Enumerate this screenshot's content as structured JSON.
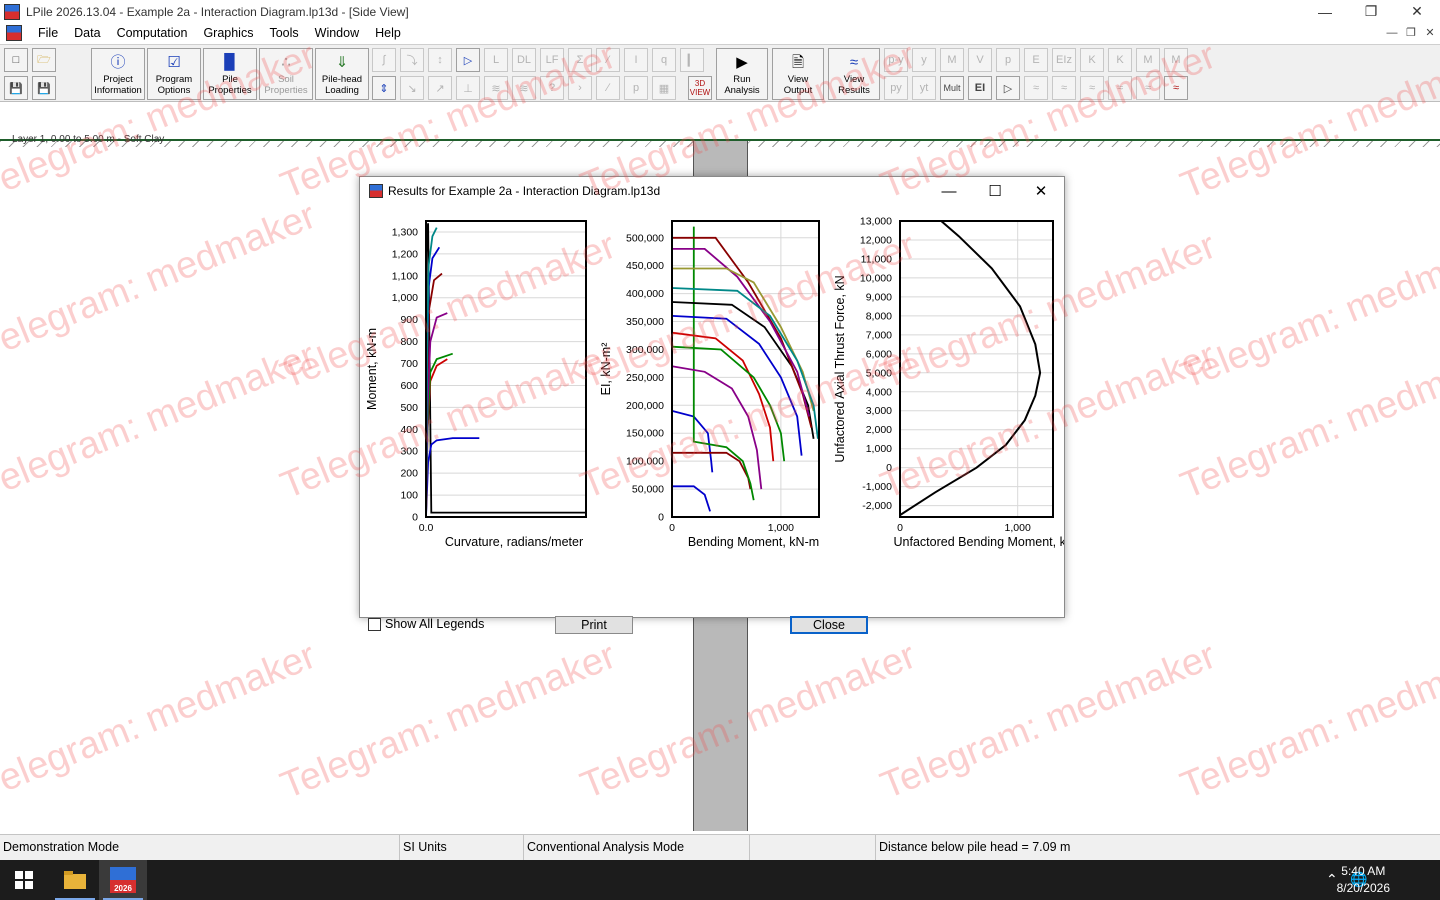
{
  "window": {
    "title": "LPile 2026.13.04 - Example 2a - Interaction Diagram.lp13d - [Side View]"
  },
  "menu": [
    "File",
    "Data",
    "Computation",
    "Graphics",
    "Tools",
    "Window",
    "Help"
  ],
  "toolbar": {
    "project_info": "Project Information",
    "program_options": "Program Options",
    "pile_properties": "Pile Properties",
    "soil_properties": "Soil Properties",
    "pilehead_loading": "Pile-head Loading",
    "view_3d": "3D VIEW",
    "run_analysis": "Run Analysis",
    "view_output": "View Output",
    "view_results": "View Results",
    "mult_label": "Mult",
    "ei_label": "EI"
  },
  "workspace": {
    "layer_label": "Layer 1, 0.00 to 5.00 m - Soft Clay"
  },
  "dialog": {
    "title": "Results for Example 2a - Interaction Diagram.lp13d",
    "show_all_legends": "Show All Legends",
    "print": "Print",
    "close": "Close"
  },
  "chart_data": [
    {
      "type": "line",
      "xlabel": "Curvature, radians/meter",
      "ylabel": "Moment, kN-m",
      "xticks": [
        "0.0"
      ],
      "yticks": [
        0,
        100,
        200,
        300,
        400,
        500,
        600,
        700,
        800,
        900,
        1000,
        1100,
        1200,
        1300
      ],
      "ytick_labels": [
        "0",
        "100",
        "200",
        "300",
        "400",
        "500",
        "600",
        "700",
        "800",
        "900",
        "1,000",
        "1,100",
        "1,200",
        "1,300"
      ],
      "ylim": [
        0,
        1350
      ],
      "xlim": [
        0,
        0.3
      ],
      "series": [
        {
          "color": "#000000",
          "x": [
            0,
            0.001,
            0.002,
            0.004,
            0.01,
            0.3
          ],
          "y": [
            0,
            1200,
            1300,
            1340,
            20,
            20
          ]
        },
        {
          "color": "#0000cc",
          "x": [
            0,
            0.004,
            0.01,
            0.02,
            0.05,
            0.1
          ],
          "y": [
            0,
            250,
            330,
            350,
            360,
            360
          ]
        },
        {
          "color": "#cc0000",
          "x": [
            0,
            0.003,
            0.008,
            0.02,
            0.04
          ],
          "y": [
            0,
            400,
            620,
            690,
            720
          ]
        },
        {
          "color": "#008800",
          "x": [
            0,
            0.003,
            0.008,
            0.02,
            0.05
          ],
          "y": [
            0,
            420,
            660,
            720,
            745
          ]
        },
        {
          "color": "#880088",
          "x": [
            0,
            0.003,
            0.008,
            0.02,
            0.04
          ],
          "y": [
            0,
            500,
            800,
            910,
            930
          ]
        },
        {
          "color": "#880000",
          "x": [
            0,
            0.002,
            0.006,
            0.015,
            0.03
          ],
          "y": [
            0,
            600,
            950,
            1080,
            1110
          ]
        },
        {
          "color": "#0000cc",
          "x": [
            0,
            0.002,
            0.005,
            0.012,
            0.025
          ],
          "y": [
            0,
            700,
            1050,
            1180,
            1230
          ]
        },
        {
          "color": "#008888",
          "x": [
            0,
            0.002,
            0.005,
            0.012,
            0.02
          ],
          "y": [
            0,
            750,
            1150,
            1280,
            1320
          ]
        }
      ]
    },
    {
      "type": "line",
      "xlabel": "Bending Moment, kN-m",
      "ylabel": "EI, kN-m²",
      "xticks": [
        0,
        1000
      ],
      "xtick_labels": [
        "0",
        "1,000"
      ],
      "yticks": [
        0,
        50000,
        100000,
        150000,
        200000,
        250000,
        300000,
        350000,
        400000,
        450000,
        500000
      ],
      "ytick_labels": [
        "0",
        "50,000",
        "100,000",
        "150,000",
        "200,000",
        "250,000",
        "300,000",
        "350,000",
        "400,000",
        "450,000",
        "500,000"
      ],
      "xlim": [
        0,
        1350
      ],
      "ylim": [
        0,
        530000
      ],
      "series": [
        {
          "color": "#0000cc",
          "x": [
            0,
            200,
            300,
            350
          ],
          "y": [
            55000,
            55000,
            40000,
            10000
          ]
        },
        {
          "color": "#0000cc",
          "x": [
            0,
            200,
            330,
            360,
            370
          ],
          "y": [
            190000,
            180000,
            150000,
            100000,
            80000
          ]
        },
        {
          "color": "#880000",
          "x": [
            0,
            300,
            500,
            620,
            700,
            720
          ],
          "y": [
            115000,
            115000,
            115000,
            100000,
            70000,
            50000
          ]
        },
        {
          "color": "#008800",
          "x": [
            200,
            200,
            500,
            650,
            720,
            750
          ],
          "y": [
            520000,
            135000,
            125000,
            100000,
            60000,
            30000
          ]
        },
        {
          "color": "#880088",
          "x": [
            0,
            300,
            550,
            700,
            780,
            820
          ],
          "y": [
            270000,
            260000,
            230000,
            180000,
            120000,
            50000
          ]
        },
        {
          "color": "#cc0000",
          "x": [
            0,
            400,
            650,
            800,
            900,
            930
          ],
          "y": [
            330000,
            320000,
            280000,
            220000,
            160000,
            100000
          ]
        },
        {
          "color": "#008800",
          "x": [
            0,
            450,
            750,
            900,
            1000,
            1030
          ],
          "y": [
            305000,
            300000,
            250000,
            200000,
            150000,
            100000
          ]
        },
        {
          "color": "#0000cc",
          "x": [
            0,
            500,
            800,
            1000,
            1150,
            1190
          ],
          "y": [
            360000,
            355000,
            310000,
            250000,
            180000,
            110000
          ]
        },
        {
          "color": "#000000",
          "x": [
            0,
            550,
            850,
            1100,
            1250,
            1300
          ],
          "y": [
            385000,
            380000,
            340000,
            270000,
            200000,
            140000
          ]
        },
        {
          "color": "#880000",
          "x": [
            0,
            400,
            700,
            1000,
            1200,
            1280
          ],
          "y": [
            500000,
            500000,
            420000,
            320000,
            220000,
            160000
          ]
        },
        {
          "color": "#880088",
          "x": [
            0,
            300,
            600,
            900,
            1150,
            1260
          ],
          "y": [
            480000,
            480000,
            430000,
            350000,
            260000,
            180000
          ]
        },
        {
          "color": "#999933",
          "x": [
            0,
            500,
            750,
            1000,
            1200,
            1300
          ],
          "y": [
            445000,
            445000,
            420000,
            340000,
            260000,
            190000
          ]
        },
        {
          "color": "#008888",
          "x": [
            0,
            600,
            900,
            1150,
            1300,
            1340
          ],
          "y": [
            410000,
            405000,
            360000,
            280000,
            200000,
            140000
          ]
        }
      ]
    },
    {
      "type": "line",
      "xlabel": "Unfactored Bending Moment, kN-m",
      "ylabel": "Unfactored Axial Thrust Force, kN",
      "xticks": [
        0,
        1000
      ],
      "xtick_labels": [
        "0",
        "1,000"
      ],
      "yticks": [
        -2000,
        -1000,
        0,
        1000,
        2000,
        3000,
        4000,
        5000,
        6000,
        7000,
        8000,
        9000,
        10000,
        11000,
        12000,
        13000
      ],
      "ytick_labels": [
        "-2,000",
        "-1,000",
        "0",
        "1,000",
        "2,000",
        "3,000",
        "4,000",
        "5,000",
        "6,000",
        "7,000",
        "8,000",
        "9,000",
        "10,000",
        "11,000",
        "12,000",
        "13,000"
      ],
      "xlim": [
        0,
        1300
      ],
      "ylim": [
        -2600,
        13000
      ],
      "series": [
        {
          "color": "#000000",
          "x": [
            0,
            300,
            650,
            900,
            1060,
            1150,
            1190,
            1150,
            1020,
            780,
            500,
            350
          ],
          "y": [
            -2500,
            -1300,
            0,
            1200,
            2500,
            3800,
            5000,
            6500,
            8500,
            10500,
            12200,
            13000
          ]
        }
      ]
    }
  ],
  "status": {
    "mode": "Demonstration Mode",
    "units": "SI Units",
    "analysis_mode": "Conventional Analysis Mode",
    "distance": "Distance below pile head = 7.09 m"
  },
  "taskbar": {
    "time": "5:40 AM",
    "date": "8/20/2026",
    "app_badge": "2026"
  },
  "watermark": "Telegram: medmaker"
}
